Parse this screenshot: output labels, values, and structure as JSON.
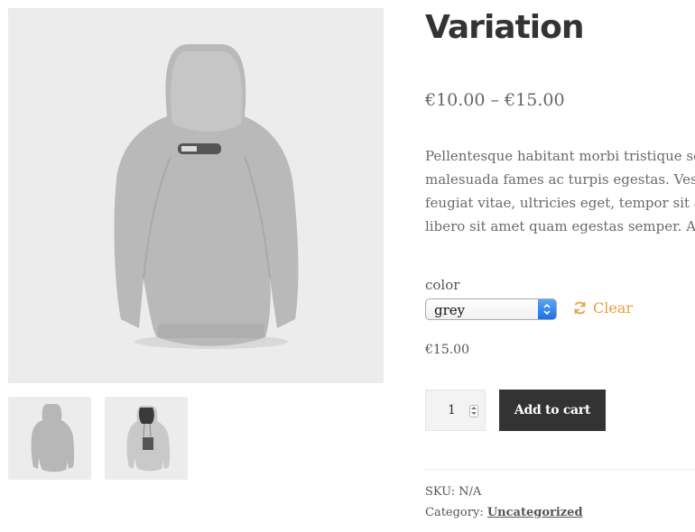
{
  "product": {
    "title": "Variation",
    "price_range": "€10.00 – €15.00",
    "description": "Pellentesque habitant morbi tristique senectus et netus et malesuada fames ac turpis egestas. Vestibulum tortor quam, feugiat vitae, ultricies eget, tempor sit amet, ante. Donec eu libero sit amet quam egestas semper. Aenean ultricies mi vitae est. Mauris placerat eleifend leo."
  },
  "variation": {
    "attribute_label": "color",
    "selected_value": "grey",
    "reset_label": "Clear",
    "price": "€15.00"
  },
  "cart": {
    "quantity": "1",
    "button_label": "Add to cart"
  },
  "meta": {
    "sku_label": "SKU:",
    "sku_value": "N/A",
    "category_label": "Category:",
    "category_value": "Uncategorized"
  },
  "icons": {
    "reset": "refresh-icon",
    "select": "chevron-updown-icon"
  },
  "colors": {
    "accent": "#e8a23a",
    "button": "#333333",
    "select_arrow": "#2f80ed"
  }
}
